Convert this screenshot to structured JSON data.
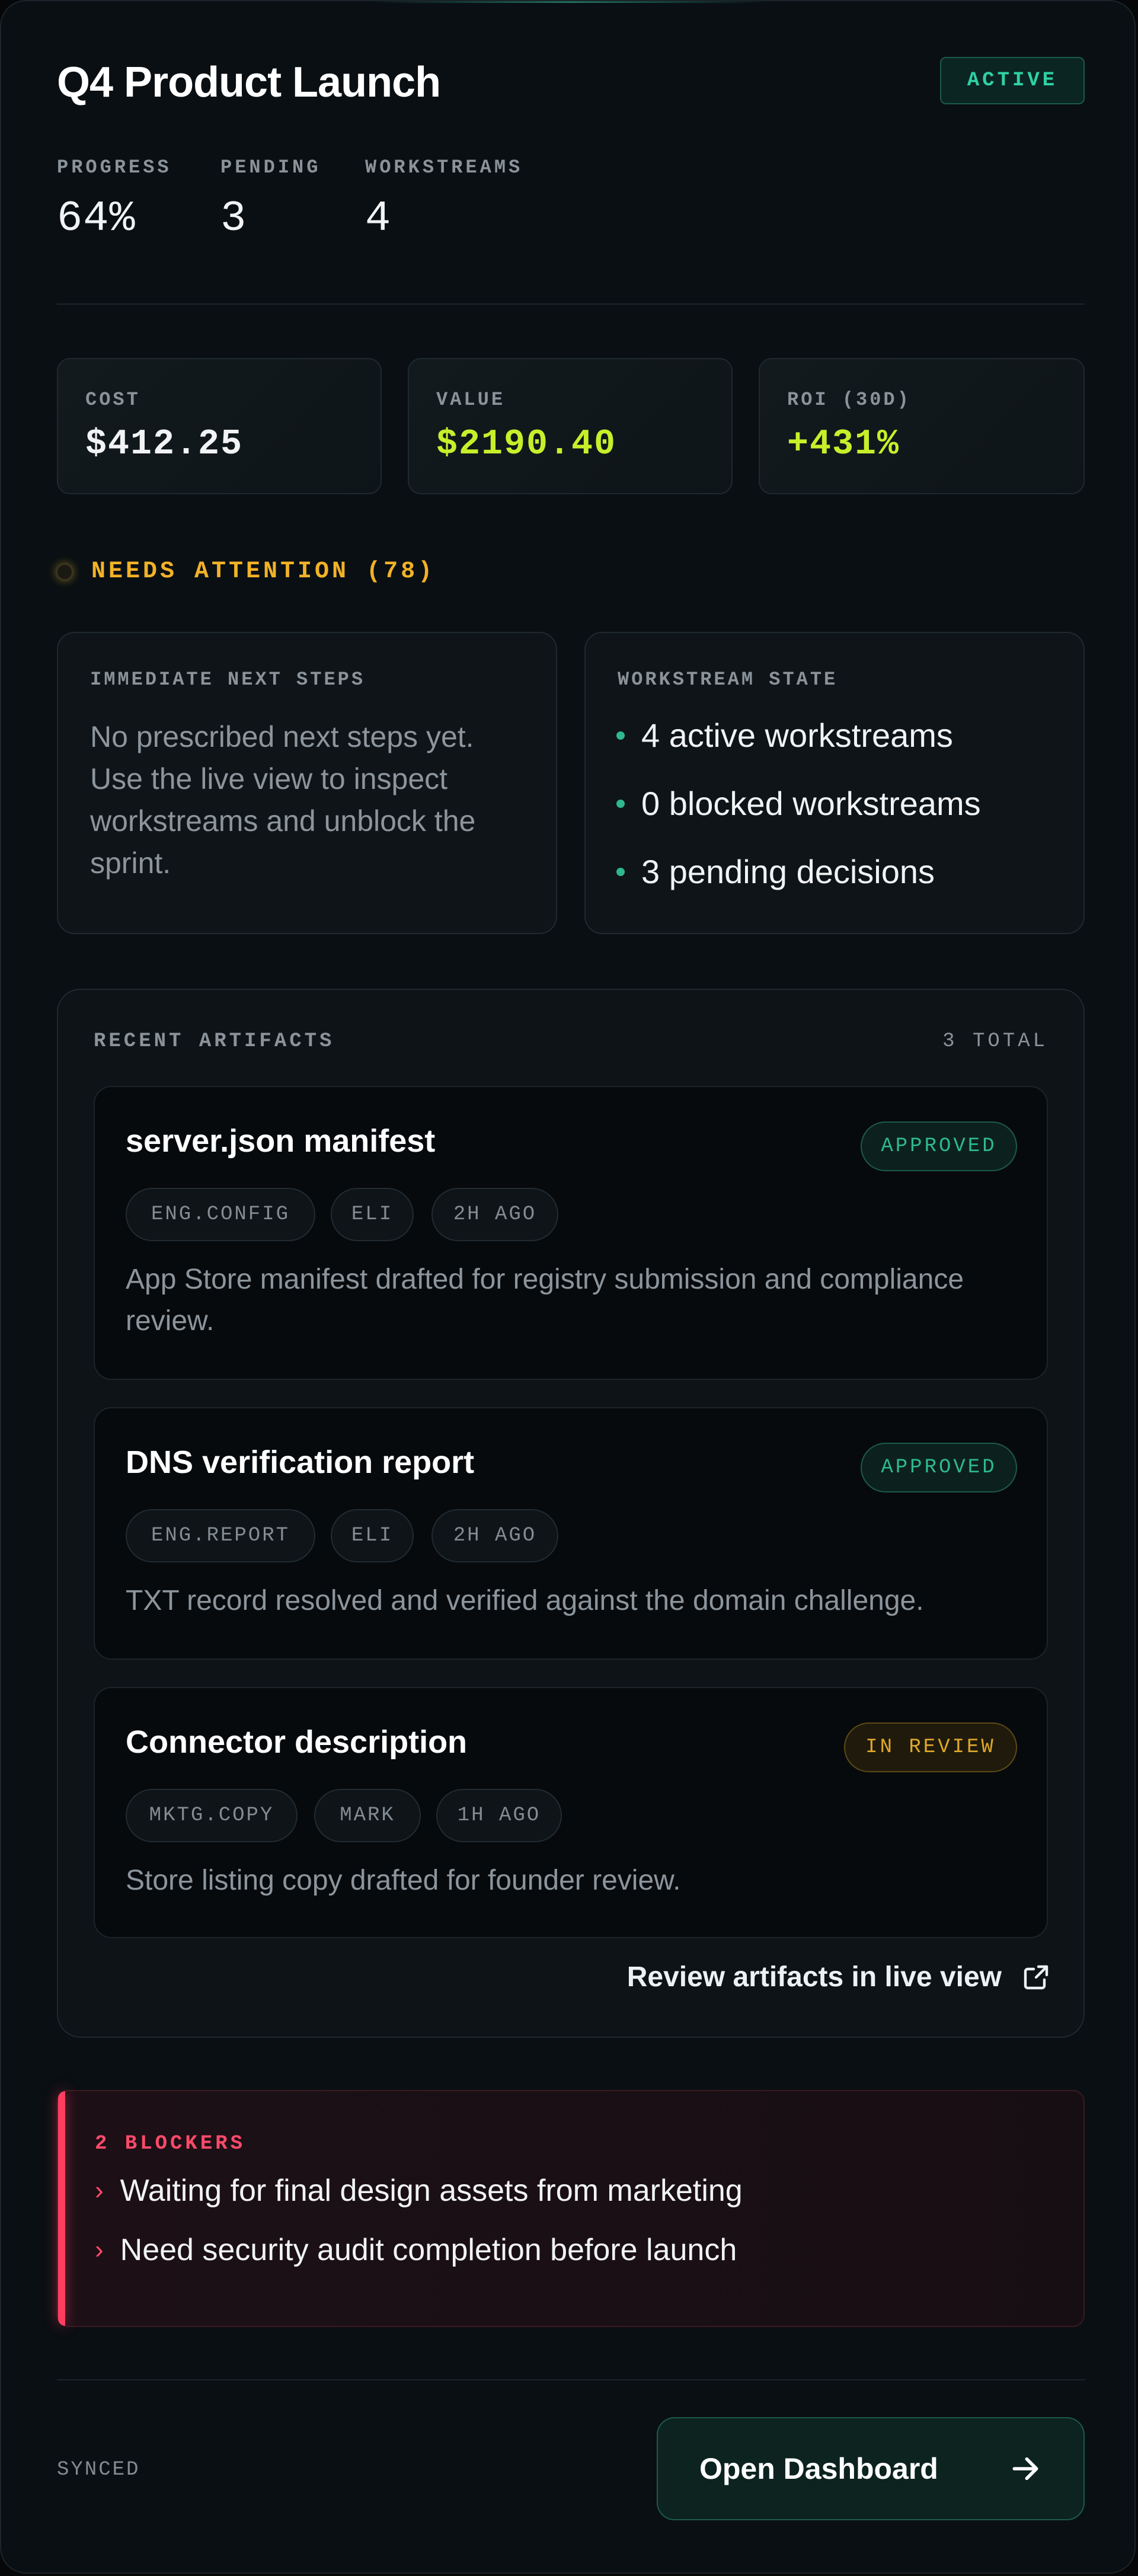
{
  "header": {
    "title": "Q4 Product Launch",
    "status": "ACTIVE"
  },
  "stats": [
    {
      "label": "PROGRESS",
      "value": "64%"
    },
    {
      "label": "PENDING",
      "value": "3"
    },
    {
      "label": "WORKSTREAMS",
      "value": "4"
    }
  ],
  "metrics": {
    "cost": {
      "label": "COST",
      "value": "$412.25"
    },
    "value": {
      "label": "VALUE",
      "value": "$2190.40"
    },
    "roi": {
      "label": "ROI (30D)",
      "value": "+431%"
    }
  },
  "attention": {
    "label": "NEEDS ATTENTION (78)"
  },
  "next_steps": {
    "label": "IMMEDIATE NEXT STEPS",
    "text": "No prescribed next steps yet. Use the live view to inspect workstreams and unblock the sprint."
  },
  "workstream_state": {
    "label": "WORKSTREAM STATE",
    "items": [
      "4 active workstreams",
      "0 blocked workstreams",
      "3 pending decisions"
    ]
  },
  "artifacts": {
    "label": "RECENT ARTIFACTS",
    "total": "3 TOTAL",
    "items": [
      {
        "name": "server.json manifest",
        "status": "APPROVED",
        "tags": [
          "ENG.CONFIG",
          "ELI",
          "2H AGO"
        ],
        "desc": "App Store manifest drafted for registry submission and compliance review."
      },
      {
        "name": "DNS verification report",
        "status": "APPROVED",
        "tags": [
          "ENG.REPORT",
          "ELI",
          "2H AGO"
        ],
        "desc": "TXT record resolved and verified against the domain challenge."
      },
      {
        "name": "Connector description",
        "status": "IN REVIEW",
        "tags": [
          "MKTG.COPY",
          "MARK",
          "1H AGO"
        ],
        "desc": "Store listing copy drafted for founder review."
      }
    ],
    "review_link": "Review artifacts in live view"
  },
  "blockers": {
    "label": "2 BLOCKERS",
    "items": [
      "Waiting for final design assets from marketing",
      "Need security audit completion before launch"
    ]
  },
  "footer": {
    "sync_status": "SYNCED",
    "dashboard_button": "Open Dashboard"
  },
  "colors": {
    "accent": "#2fd1a4",
    "value_green": "#c6f02a",
    "warning": "#f2b227",
    "danger": "#ff4a6a"
  }
}
